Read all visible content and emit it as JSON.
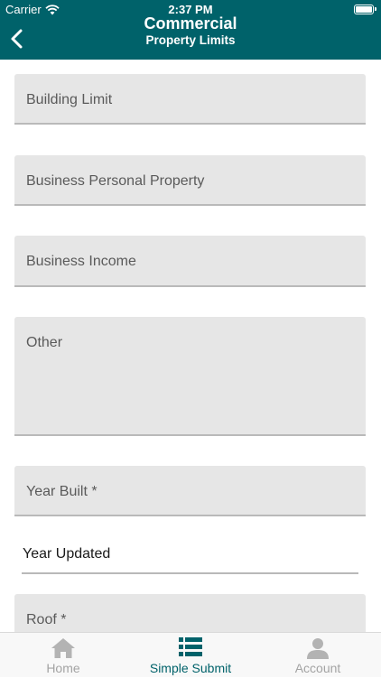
{
  "status_bar": {
    "carrier": "Carrier",
    "time": "2:37 PM"
  },
  "nav": {
    "title": "Commercial",
    "subtitle": "Property Limits"
  },
  "form": {
    "fields": [
      {
        "label": "Building Limit"
      },
      {
        "label": "Business Personal Property"
      },
      {
        "label": "Business Income"
      },
      {
        "label": "Other"
      },
      {
        "label": "Year Built *"
      },
      {
        "label": "Year Updated"
      },
      {
        "label": "Roof *"
      }
    ]
  },
  "tab_bar": {
    "tabs": [
      {
        "label": "Home",
        "icon": "home-icon"
      },
      {
        "label": "Simple Submit",
        "icon": "list-icon"
      },
      {
        "label": "Account",
        "icon": "person-icon"
      }
    ],
    "active_tab": "Simple Submit"
  },
  "colors": {
    "header_bg": "#00626a",
    "active_tab": "#00626a",
    "inactive_tab": "#a3a3a3",
    "field_bg": "#e6e6e6"
  }
}
